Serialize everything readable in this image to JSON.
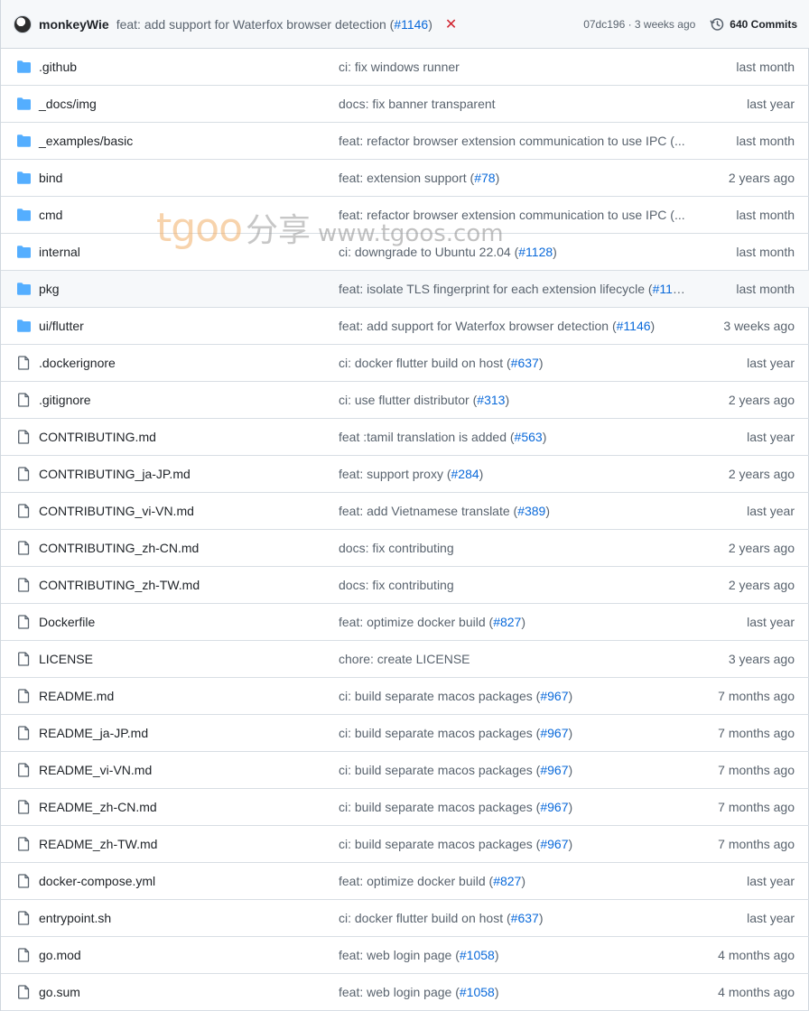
{
  "latest_commit": {
    "author": "monkeyWie",
    "message_prefix": "feat: add support for Waterfox browser detection (",
    "message_pr": "#1146",
    "message_suffix": ")",
    "status_icon": "x-icon",
    "sha_age": "07dc196 · 3 weeks ago",
    "commits_label": "640 Commits"
  },
  "watermark": {
    "brand_a": "tgoo",
    "brand_b": "分享",
    "url": "www.tgoos.com"
  },
  "colors": {
    "folder": "#54aeff",
    "link": "#0969da",
    "muted": "#59636e",
    "fail": "#d1242f"
  },
  "files": [
    {
      "type": "folder",
      "name": ".github",
      "msg": "ci: fix windows runner",
      "pr": "",
      "tail": "",
      "age": "last month"
    },
    {
      "type": "folder",
      "name": "_docs/img",
      "msg": "docs: fix banner transparent",
      "pr": "",
      "tail": "",
      "age": "last year"
    },
    {
      "type": "folder",
      "name": "_examples/basic",
      "msg": "feat: refactor browser extension communication to use IPC (...",
      "pr": "",
      "tail": "",
      "age": "last month"
    },
    {
      "type": "folder",
      "name": "bind",
      "msg": "feat: extension support (",
      "pr": "#78",
      "tail": ")",
      "age": "2 years ago"
    },
    {
      "type": "folder",
      "name": "cmd",
      "msg": "feat: refactor browser extension communication to use IPC (...",
      "pr": "",
      "tail": "",
      "age": "last month"
    },
    {
      "type": "folder",
      "name": "internal",
      "msg": "ci: downgrade to Ubuntu 22.04 (",
      "pr": "#1128",
      "tail": ")",
      "age": "last month"
    },
    {
      "type": "folder",
      "name": "pkg",
      "msg": "feat: isolate TLS fingerprint for each extension lifecycle (",
      "pr": "#113...",
      "tail": "",
      "age": "last month",
      "hover": true
    },
    {
      "type": "folder",
      "name": "ui/flutter",
      "msg": "feat: add support for Waterfox browser detection (",
      "pr": "#1146",
      "tail": ")",
      "age": "3 weeks ago"
    },
    {
      "type": "file",
      "name": ".dockerignore",
      "msg": "ci: docker flutter build on host (",
      "pr": "#637",
      "tail": ")",
      "age": "last year"
    },
    {
      "type": "file",
      "name": ".gitignore",
      "msg": "ci: use flutter distributor (",
      "pr": "#313",
      "tail": ")",
      "age": "2 years ago"
    },
    {
      "type": "file",
      "name": "CONTRIBUTING.md",
      "msg": "feat :tamil translation is added (",
      "pr": "#563",
      "tail": ")",
      "age": "last year"
    },
    {
      "type": "file",
      "name": "CONTRIBUTING_ja-JP.md",
      "msg": "feat: support proxy (",
      "pr": "#284",
      "tail": ")",
      "age": "2 years ago"
    },
    {
      "type": "file",
      "name": "CONTRIBUTING_vi-VN.md",
      "msg": "feat: add Vietnamese translate (",
      "pr": "#389",
      "tail": ")",
      "age": "last year"
    },
    {
      "type": "file",
      "name": "CONTRIBUTING_zh-CN.md",
      "msg": "docs: fix contributing",
      "pr": "",
      "tail": "",
      "age": "2 years ago"
    },
    {
      "type": "file",
      "name": "CONTRIBUTING_zh-TW.md",
      "msg": "docs: fix contributing",
      "pr": "",
      "tail": "",
      "age": "2 years ago"
    },
    {
      "type": "file",
      "name": "Dockerfile",
      "msg": "feat: optimize docker build (",
      "pr": "#827",
      "tail": ")",
      "age": "last year"
    },
    {
      "type": "file",
      "name": "LICENSE",
      "msg": "chore: create LICENSE",
      "pr": "",
      "tail": "",
      "age": "3 years ago"
    },
    {
      "type": "file",
      "name": "README.md",
      "msg": "ci: build separate macos packages (",
      "pr": "#967",
      "tail": ")",
      "age": "7 months ago"
    },
    {
      "type": "file",
      "name": "README_ja-JP.md",
      "msg": "ci: build separate macos packages (",
      "pr": "#967",
      "tail": ")",
      "age": "7 months ago"
    },
    {
      "type": "file",
      "name": "README_vi-VN.md",
      "msg": "ci: build separate macos packages (",
      "pr": "#967",
      "tail": ")",
      "age": "7 months ago"
    },
    {
      "type": "file",
      "name": "README_zh-CN.md",
      "msg": "ci: build separate macos packages (",
      "pr": "#967",
      "tail": ")",
      "age": "7 months ago"
    },
    {
      "type": "file",
      "name": "README_zh-TW.md",
      "msg": "ci: build separate macos packages (",
      "pr": "#967",
      "tail": ")",
      "age": "7 months ago"
    },
    {
      "type": "file",
      "name": "docker-compose.yml",
      "msg": "feat: optimize docker build (",
      "pr": "#827",
      "tail": ")",
      "age": "last year"
    },
    {
      "type": "file",
      "name": "entrypoint.sh",
      "msg": "ci: docker flutter build on host (",
      "pr": "#637",
      "tail": ")",
      "age": "last year"
    },
    {
      "type": "file",
      "name": "go.mod",
      "msg": "feat: web login page (",
      "pr": "#1058",
      "tail": ")",
      "age": "4 months ago"
    },
    {
      "type": "file",
      "name": "go.sum",
      "msg": "feat: web login page (",
      "pr": "#1058",
      "tail": ")",
      "age": "4 months ago"
    }
  ]
}
